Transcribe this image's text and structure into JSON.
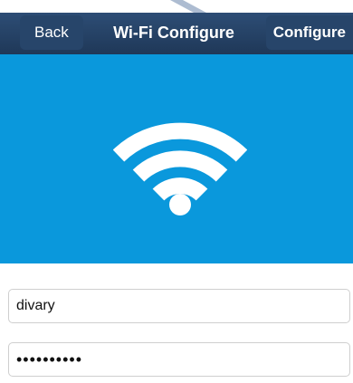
{
  "navbar": {
    "back_label": "Back",
    "title": "Wi-Fi Configure",
    "configure_label": "Configure"
  },
  "hero": {
    "background_color": "#0a98dc",
    "icon": "wifi-icon",
    "help_label": "?"
  },
  "form": {
    "ssid_value": "divary",
    "password_value": "••••••••••"
  }
}
